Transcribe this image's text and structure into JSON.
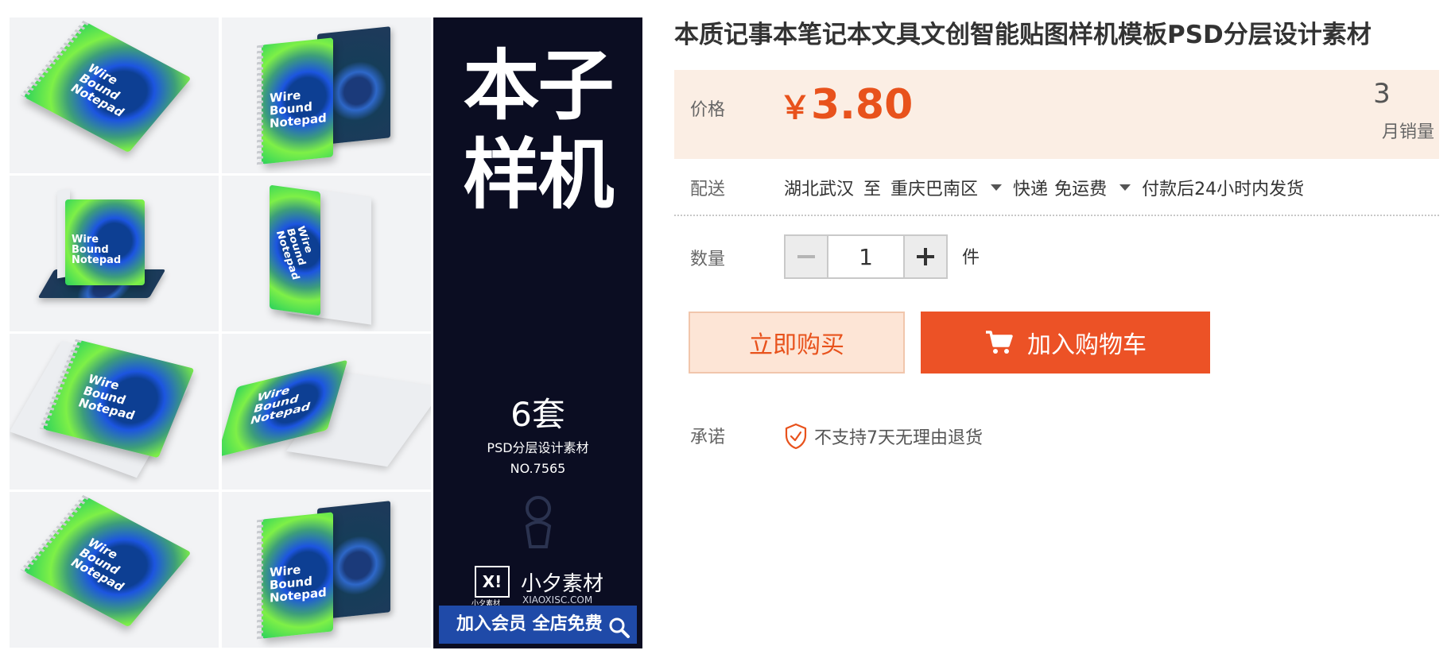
{
  "gallery": {
    "pad_text": "Wire\nBound\nNotepad",
    "banner": {
      "title": "本子\n样机",
      "sets": "6套",
      "subtitle": "PSD分层设计素材",
      "number": "NO.7565",
      "logo_mark": "X!",
      "logo_caption": "小夕素材",
      "brand": "小夕素材",
      "url": "XIAOXISC.COM",
      "bar_text": "加入会员 全店免费"
    },
    "icons": [
      "magnifier-icon"
    ]
  },
  "product": {
    "title": "本质记事本笔记本文具文创智能贴图样机模板PSD分层设计素材",
    "price_label": "价格",
    "currency": "￥",
    "price": "3.80",
    "monthly_sales_value": "3",
    "monthly_sales_label": "月销量",
    "delivery_label": "配送",
    "origin": "湖北武汉",
    "to": "至",
    "destination": "重庆巴南区",
    "shipping_method": "快递",
    "shipping_fee": "免运费",
    "dispatch_note": "付款后24小时内发货",
    "quantity_label": "数量",
    "quantity": "1",
    "quantity_unit": "件",
    "buy_now_label": "立即购买",
    "add_to_cart_label": "加入购物车",
    "promise_label": "承诺",
    "promise_text": "不支持7天无理由退货"
  },
  "colors": {
    "accent": "#e8521c",
    "cart_button": "#ec5226",
    "price_bg": "#fbeee4",
    "banner_bg": "#0b0d22",
    "banner_bar": "#1f4aa8"
  }
}
